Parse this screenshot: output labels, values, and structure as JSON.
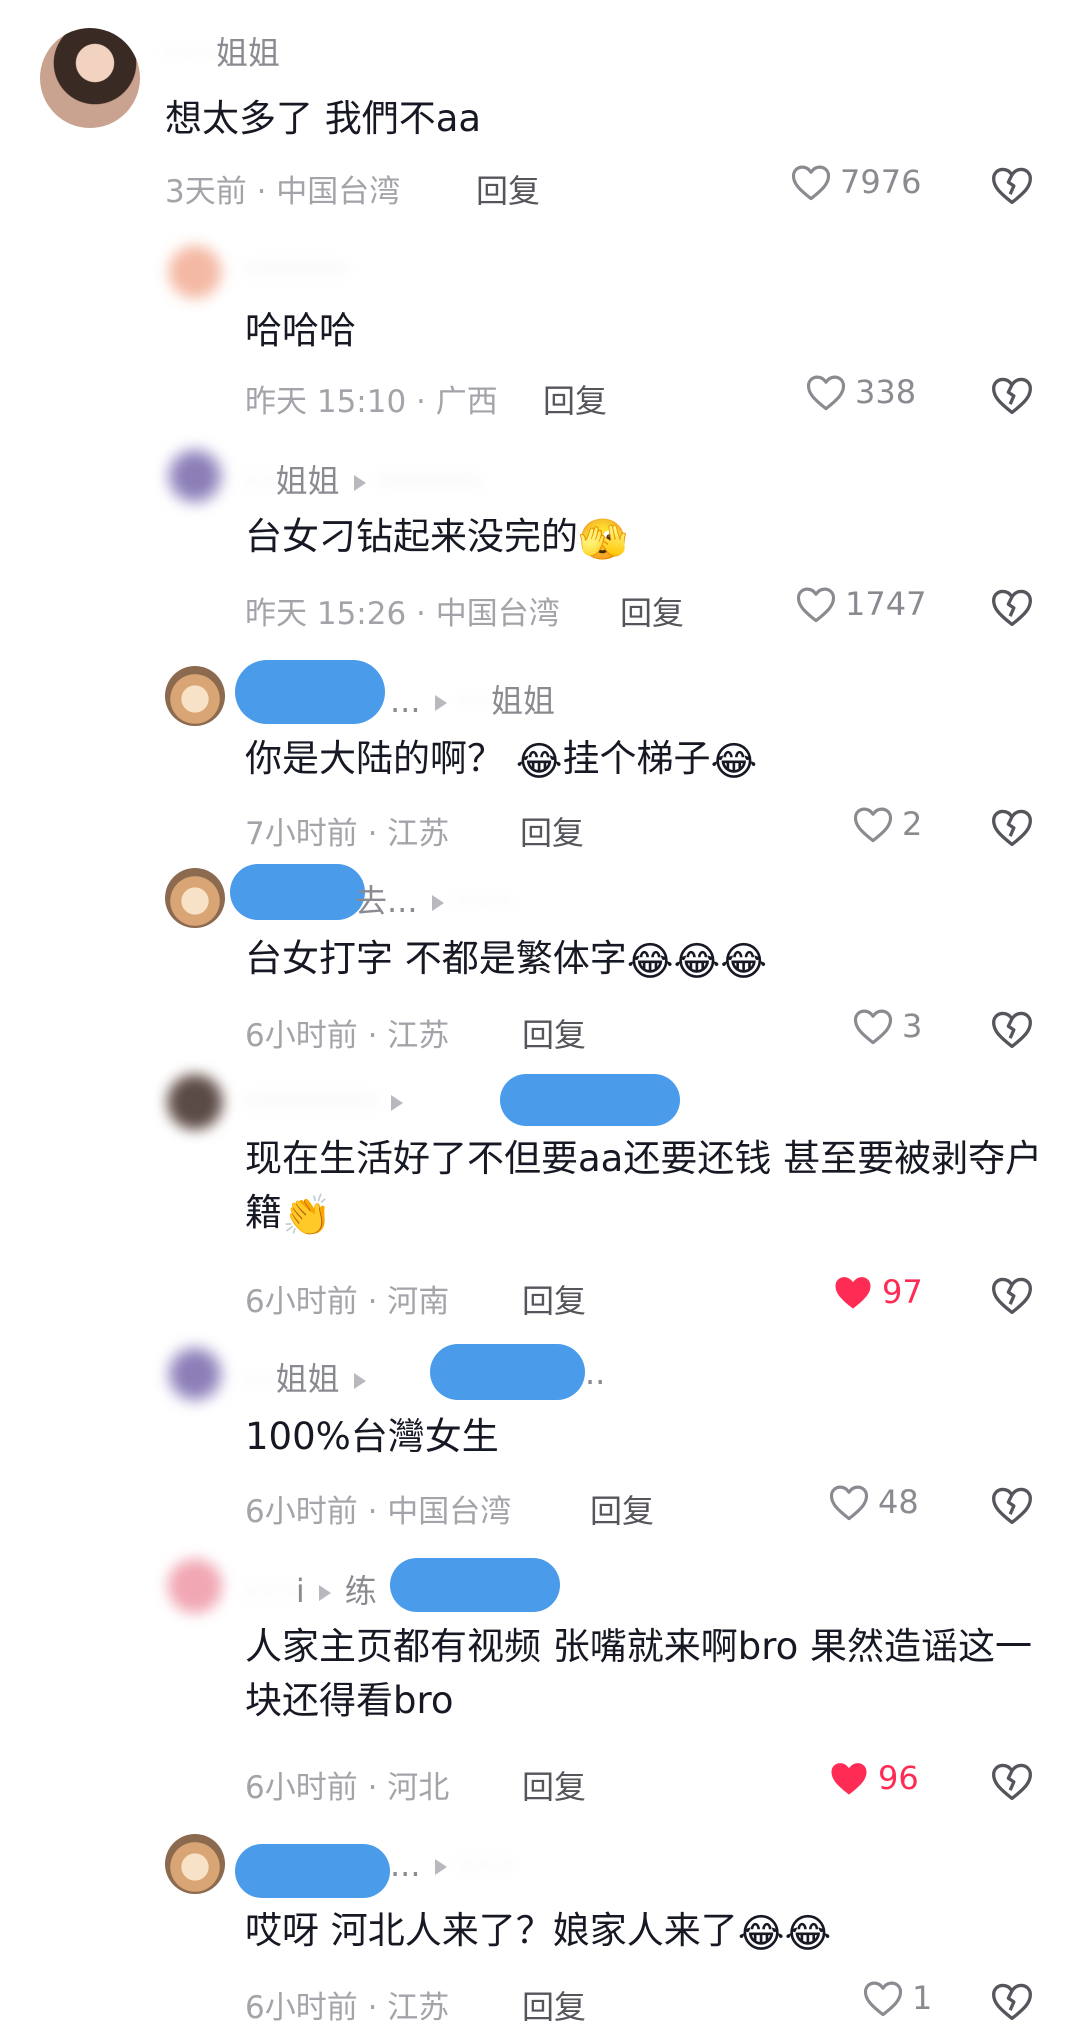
{
  "comments": [
    {
      "name_visible": "姐姐",
      "name_blur": "·  ·  ·",
      "text": "想太多了 我們不aa",
      "time": "3天前 · 中国台湾",
      "reply": "回复",
      "likes": "7976",
      "liked": false
    },
    {
      "name_blur": "··········",
      "text": "哈哈哈",
      "time": "昨天 15:10 · 广西",
      "reply": "回复",
      "likes": "338",
      "liked": false
    },
    {
      "name_visible": "姐姐",
      "name_blur": "· ·",
      "target_blur": "··········",
      "text": "台女刁钻起来没完的",
      "emoji": "🫣",
      "time": "昨天 15:26 · 中国台湾",
      "reply": "回复",
      "likes": "1747",
      "liked": false
    },
    {
      "name_suffix": "...",
      "target_visible": "姐姐",
      "target_blur": "· ·",
      "text": "你是大陆的啊？",
      "emoji1": "😂",
      "text2": "挂个梯子",
      "emoji2": "😂",
      "time": "7小时前 · 江苏",
      "reply": "回复",
      "likes": "2",
      "liked": false
    },
    {
      "name_suffix": "去...",
      "target_blur": "· · ·",
      "text": "台女打字 不都是繁体字",
      "emojis": "😂😂😂",
      "time": "6小时前 · 江苏",
      "reply": "回复",
      "likes": "3",
      "liked": false
    },
    {
      "name_blur": "·············",
      "text": "现在生活好了不但要aa还要还钱 甚至要被剥夺户籍",
      "emoji": "👏",
      "time": "6小时前 · 河南",
      "reply": "回复",
      "likes": "97",
      "liked": true
    },
    {
      "name_visible": "姐姐",
      "name_blur": "· ·",
      "name_suffix": "..",
      "text": "100%台灣女生",
      "time": "6小时前 · 中国台湾",
      "reply": "回复",
      "likes": "48",
      "liked": false
    },
    {
      "name_visible": "i",
      "name_blur": "· · ·",
      "target_visible": "练",
      "text": "人家主页都有视频 张嘴就来啊bro 果然造谣这一块还得看bro",
      "time": "6小时前 · 河北",
      "reply": "回复",
      "likes": "96",
      "liked": true
    },
    {
      "name_visible": "...",
      "target_blur": "· · ·",
      "text": "哎呀 河北人来了？娘家人来了",
      "emojis": "😂😂",
      "time": "6小时前 · 江苏",
      "reply": "回复",
      "likes": "1",
      "liked": false
    }
  ],
  "colors": {
    "like_red": "#fe2c55",
    "redact_blue": "#4a9bea",
    "text": "#161823",
    "meta": "#a3a4a9"
  },
  "icons": {
    "like": "heart-icon",
    "dislike": "broken-heart-icon",
    "arrow": "reply-to-arrow-icon"
  }
}
